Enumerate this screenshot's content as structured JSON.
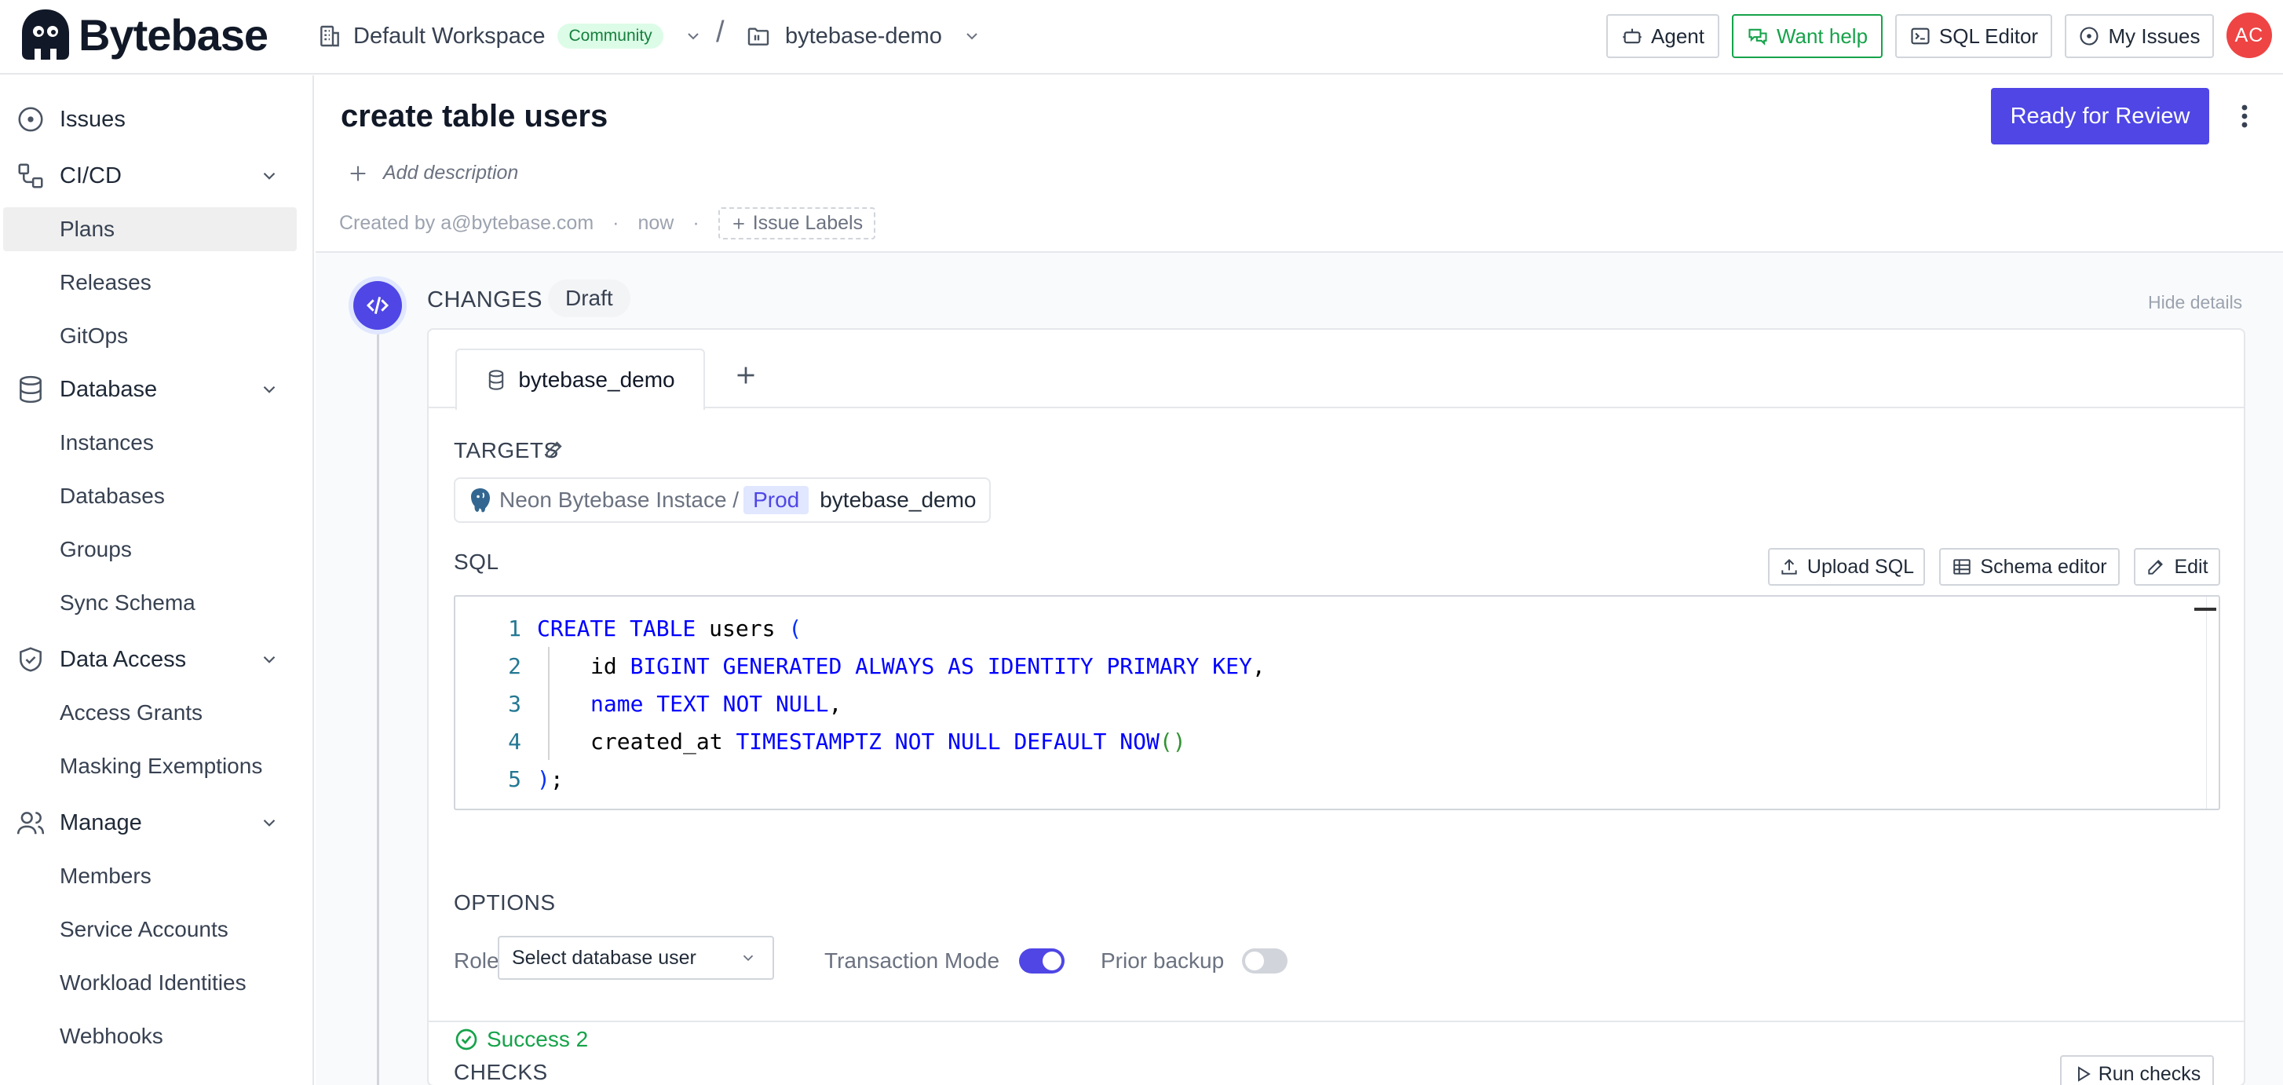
{
  "header": {
    "brand": "Bytebase",
    "workspace": "Default Workspace",
    "plan_badge": "Community",
    "separator": "/",
    "project": "bytebase-demo",
    "buttons": {
      "agent": "Agent",
      "want_help": "Want help",
      "sql_editor": "SQL Editor",
      "my_issues": "My Issues"
    },
    "avatar_initials": "AC"
  },
  "sidebar": {
    "issues": "Issues",
    "cicd": {
      "label": "CI/CD",
      "items": [
        "Plans",
        "Releases",
        "GitOps"
      ]
    },
    "database": {
      "label": "Database",
      "items": [
        "Instances",
        "Databases",
        "Groups",
        "Sync Schema"
      ]
    },
    "data_access": {
      "label": "Data Access",
      "items": [
        "Access Grants",
        "Masking Exemptions"
      ]
    },
    "manage": {
      "label": "Manage",
      "items": [
        "Members",
        "Service Accounts",
        "Workload Identities",
        "Webhooks"
      ]
    },
    "active_item": "Plans"
  },
  "issue": {
    "title": "create table users",
    "ready_button": "Ready for Review",
    "add_description": "Add description",
    "created_by": "Created by a@bytebase.com",
    "created_when": "now",
    "meta_separator": "·",
    "labels_button": "Issue Labels"
  },
  "changes": {
    "section_label": "CHANGES",
    "status_badge": "Draft",
    "hide_details": "Hide details",
    "tab_label": "bytebase_demo",
    "targets_label": "TARGETS",
    "target": {
      "instance": "Neon Bytebase Instace /",
      "environment": "Prod",
      "database": "bytebase_demo"
    },
    "sql_label": "SQL",
    "sql_buttons": {
      "upload": "Upload SQL",
      "schema_editor": "Schema editor",
      "edit": "Edit"
    },
    "sql_lines": [
      {
        "n": "1"
      },
      {
        "n": "2"
      },
      {
        "n": "3"
      },
      {
        "n": "4"
      },
      {
        "n": "5"
      }
    ],
    "sql_tokens": {
      "create_table": "CREATE TABLE",
      "users": " users ",
      "open_paren": "(",
      "id": "id ",
      "id_type": "BIGINT GENERATED ALWAYS AS IDENTITY PRIMARY KEY",
      "comma": ",",
      "name_col": "name",
      "name_type": " TEXT NOT NULL",
      "created_at": "created_at ",
      "created_type": "TIMESTAMPTZ NOT NULL DEFAULT NOW",
      "fn_parens": "()",
      "close": ")",
      "semicolon": ";"
    },
    "options_label": "OPTIONS",
    "role_label": "Role",
    "role_placeholder": "Select database user",
    "transaction_mode_label": "Transaction Mode",
    "transaction_mode_on": true,
    "prior_backup_label": "Prior backup",
    "prior_backup_on": false,
    "checks_label": "CHECKS",
    "run_checks": "Run checks",
    "checks_result": "Success 2"
  },
  "colors": {
    "accent": "#4f46e5",
    "success": "#16a34a",
    "avatar": "#ef4444"
  },
  "icons": [
    "bytebase-logo",
    "building-icon",
    "chevron-down-icon",
    "folder-icon",
    "agent-icon",
    "chat-icon",
    "terminal-icon",
    "circle-dot-icon",
    "workflow-icon",
    "database-icon",
    "shield-check-icon",
    "users-icon",
    "plus-icon",
    "more-vertical-icon",
    "code-icon",
    "pencil-icon",
    "postgres-icon",
    "upload-icon",
    "table-icon",
    "play-icon",
    "check-circle-icon"
  ]
}
